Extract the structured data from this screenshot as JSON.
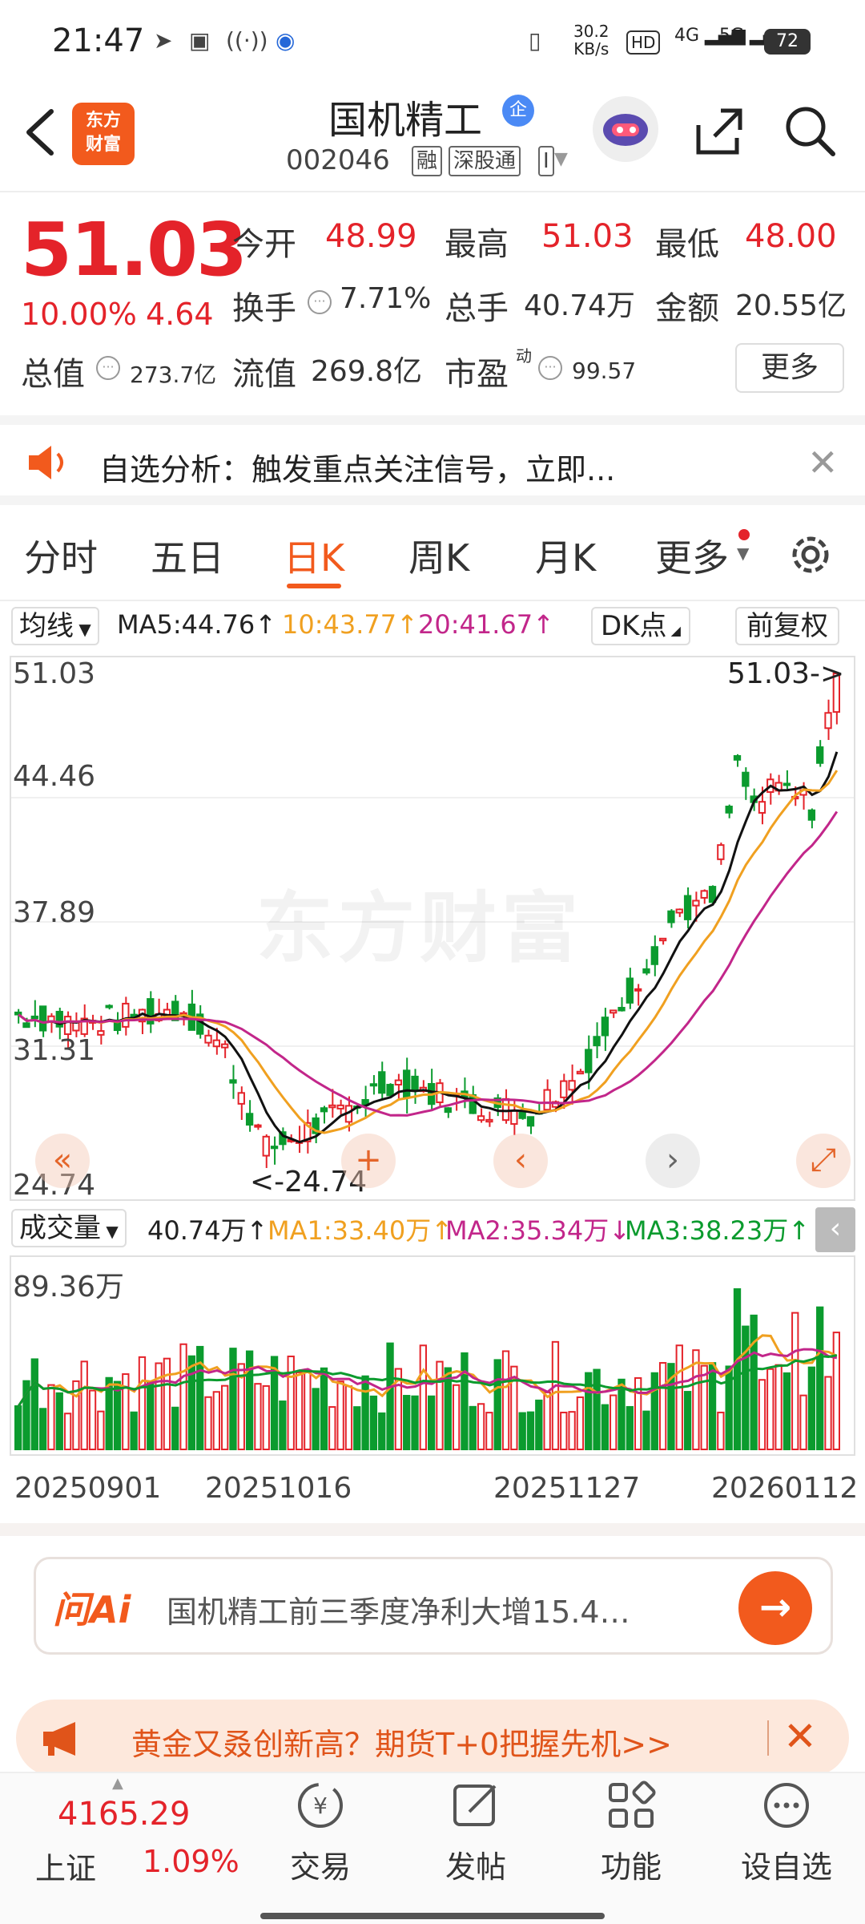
{
  "status": {
    "time": "21:47",
    "net_speed_top": "30.2",
    "net_speed_unit": "KB/s",
    "hd_label": "HD",
    "sim1": "4G",
    "sim2": "5G",
    "battery": "72"
  },
  "header": {
    "logo_line1": "东方",
    "logo_line2": "财富",
    "stock_name": "国机精工",
    "badge": "企",
    "stock_code": "002046",
    "tags": [
      "融",
      "深股通",
      "I"
    ]
  },
  "quote": {
    "price": "51.03",
    "change_pct": "10.00%",
    "change_amt": "4.64",
    "open_label": "今开",
    "open": "48.99",
    "high_label": "最高",
    "high": "51.03",
    "low_label": "最低",
    "low": "48.00",
    "turnover_label": "换手",
    "turnover": "7.71%",
    "volume_label": "总手",
    "volume": "40.74万",
    "amount_label": "金额",
    "amount": "20.55亿",
    "mktcap_label": "总值",
    "mktcap": "273.7亿",
    "float_label": "流值",
    "float": "269.8亿",
    "pe_label": "市盈",
    "pe_sup": "动",
    "pe": "99.57",
    "more": "更多"
  },
  "alert": {
    "text": "自选分析：触发重点关注信号，立即..."
  },
  "tabs": [
    "分时",
    "五日",
    "日K",
    "周K",
    "月K",
    "更多"
  ],
  "active_tab": "日K",
  "chart_toolbar": {
    "ma_select": "均线",
    "ma5": "MA5:44.76",
    "ma10": "10:43.77",
    "ma20": "20:41.67",
    "dk": "DK点",
    "fq": "前复权"
  },
  "kline": {
    "y_labels": [
      "51.03",
      "44.46",
      "37.89",
      "31.31",
      "24.74"
    ],
    "max_marker": "51.03->",
    "min_marker": "<-24.74",
    "watermark": "东方财富"
  },
  "volume_toolbar": {
    "select": "成交量",
    "current": "40.74万",
    "ma1": "MA1:33.40万",
    "ma2": "MA2:35.34万",
    "ma3": "MA3:38.23万",
    "max_label": "89.36万"
  },
  "dates": [
    "20250901",
    "20251016",
    "20251127",
    "20260112"
  ],
  "ai_bar": {
    "logo": "问Ai",
    "text": "国机精工前三季度净利大增15.4…"
  },
  "promo": {
    "text": "黄金又叒创新高？期货T+0把握先机>>"
  },
  "bottom_nav": {
    "index_value": "4165.29",
    "index_name": "上证",
    "index_pct": "1.09%",
    "items": [
      "交易",
      "发帖",
      "功能",
      "设自选"
    ]
  },
  "colors": {
    "up": "#e4232a",
    "down": "#0b9b2e",
    "accent": "#f25a1d",
    "ma5": "#111111",
    "ma10": "#f0a020",
    "ma20": "#c2268a"
  },
  "chart_data": {
    "type": "candlestick",
    "price_range": [
      24.74,
      51.03
    ],
    "volume_max_wan": 89.36,
    "last_close": 51.03,
    "indicators": {
      "MA5": 44.76,
      "MA10": 43.77,
      "MA20": 41.67
    },
    "volume_indicators": {
      "MA1": "33.40万",
      "MA2": "35.34万",
      "MA3": "38.23万"
    }
  }
}
